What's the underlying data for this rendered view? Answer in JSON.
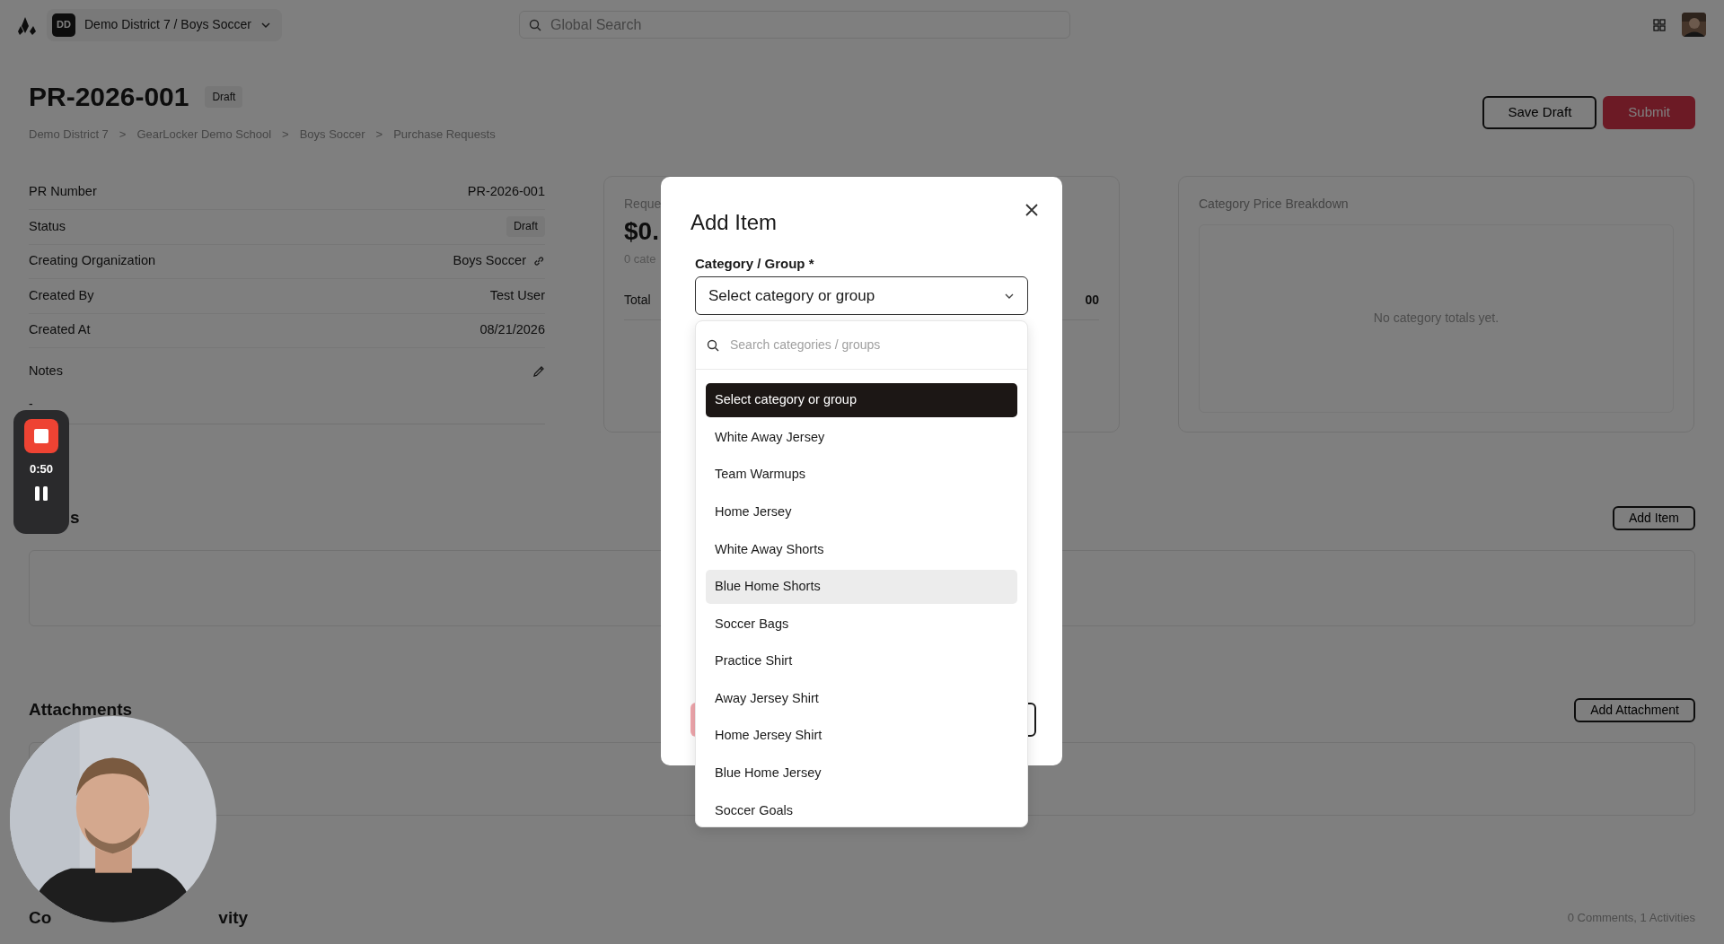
{
  "topbar": {
    "org_initials": "DD",
    "org_name": "Demo District 7 / Boys Soccer",
    "search_placeholder": "Global Search"
  },
  "header": {
    "title": "PR-2026-001",
    "status": "Draft",
    "breadcrumb_separator": ">",
    "breadcrumbs": [
      "Demo District 7",
      "GearLocker Demo School",
      "Boys Soccer",
      "Purchase Requests"
    ],
    "buttons": [
      {
        "label": "Save Draft",
        "kind": "outline"
      },
      {
        "label": "Submit",
        "kind": "primary"
      }
    ]
  },
  "details": {
    "rows": [
      {
        "label": "PR Number",
        "value": "PR-2026-001",
        "kind": "text"
      },
      {
        "label": "Status",
        "value": "Draft",
        "kind": "badge"
      },
      {
        "label": "Creating Organization",
        "value": "Boys Soccer",
        "kind": "link"
      },
      {
        "label": "Created By",
        "value": "Test User",
        "kind": "text"
      },
      {
        "label": "Created At",
        "value": "08/21/2026",
        "kind": "text"
      }
    ],
    "notes": {
      "label": "Notes",
      "value": "-"
    }
  },
  "request_card": {
    "label": "Reque",
    "amount": "$0.",
    "subtitle": "0 cate",
    "total_label": "Total",
    "total_value": "00"
  },
  "breakdown_card": {
    "title": "Category Price Breakdown",
    "empty_text": "No category totals yet."
  },
  "items_section": {
    "title": "s",
    "button": "Add Item"
  },
  "attachments_section": {
    "title": "Attachments",
    "button": "Add Attachment"
  },
  "activity_section": {
    "title_parts": [
      "Co",
      "vity"
    ],
    "summary": "0 Comments, 1 Activities"
  },
  "modal": {
    "title": "Add Item",
    "field_label": "Category / Group *",
    "select_value": "Select category or group",
    "search_placeholder": "Search categories / groups",
    "options": [
      {
        "label": "Select category or group",
        "selected": true,
        "hovered": false
      },
      {
        "label": "White Away Jersey",
        "selected": false,
        "hovered": false
      },
      {
        "label": "Team Warmups",
        "selected": false,
        "hovered": false
      },
      {
        "label": "Home Jersey",
        "selected": false,
        "hovered": false
      },
      {
        "label": "White Away Shorts",
        "selected": false,
        "hovered": false
      },
      {
        "label": "Blue Home Shorts",
        "selected": false,
        "hovered": true
      },
      {
        "label": "Soccer Bags",
        "selected": false,
        "hovered": false
      },
      {
        "label": "Practice Shirt",
        "selected": false,
        "hovered": false
      },
      {
        "label": "Away Jersey Shirt",
        "selected": false,
        "hovered": false
      },
      {
        "label": "Home Jersey Shirt",
        "selected": false,
        "hovered": false
      },
      {
        "label": "Blue Home Jersey",
        "selected": false,
        "hovered": false
      },
      {
        "label": "Soccer Goals",
        "selected": false,
        "hovered": false
      }
    ]
  },
  "recorder": {
    "time": "0:50"
  }
}
